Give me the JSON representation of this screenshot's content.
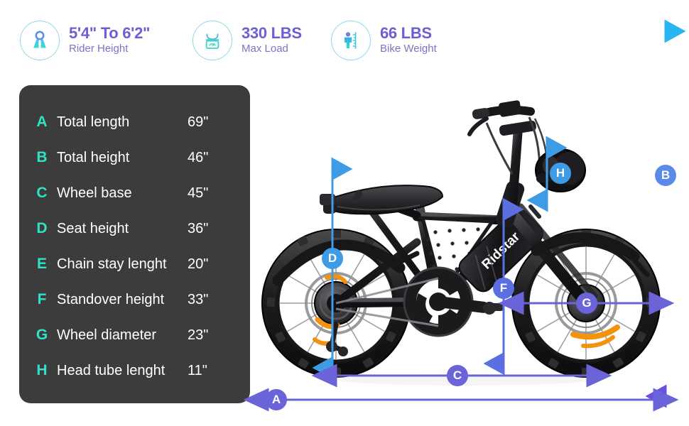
{
  "header": {
    "stats": [
      {
        "icon": "rider-height-icon",
        "value": "5'4\" To 6'2\"",
        "label": "Rider Height"
      },
      {
        "icon": "scale-icon",
        "value": "330 LBS",
        "label": "Max Load"
      },
      {
        "icon": "bike-weight-ruler-icon",
        "value": "66 LBS",
        "label": "Bike Weight"
      }
    ]
  },
  "spec_panel": {
    "rows": [
      {
        "letter": "A",
        "label": "Total length",
        "value": "69\""
      },
      {
        "letter": "B",
        "label": "Total height",
        "value": "46\""
      },
      {
        "letter": "C",
        "label": "Wheel base",
        "value": "45\""
      },
      {
        "letter": "D",
        "label": "Seat height",
        "value": "36\""
      },
      {
        "letter": "E",
        "label": "Chain stay lenght",
        "value": "20\""
      },
      {
        "letter": "F",
        "label": "Standover height",
        "value": "33\""
      },
      {
        "letter": "G",
        "label": "Wheel diameter",
        "value": "23\""
      },
      {
        "letter": "H",
        "label": "Head tube lenght",
        "value": "11\""
      }
    ]
  },
  "bike": {
    "brand_text": "Ridstar",
    "dimension_markers": [
      {
        "letter": "A",
        "orientation": "horizontal",
        "color": "#6b63d8"
      },
      {
        "letter": "B",
        "orientation": "vertical",
        "color": "#5b8ae8"
      },
      {
        "letter": "C",
        "orientation": "horizontal",
        "color": "#6b63d8"
      },
      {
        "letter": "D",
        "orientation": "vertical",
        "color": "#3e9ce6"
      },
      {
        "letter": "F",
        "orientation": "vertical",
        "color": "#5b6fe0"
      },
      {
        "letter": "G",
        "orientation": "horizontal",
        "color": "#6b63d8"
      },
      {
        "letter": "H",
        "orientation": "vertical",
        "color": "#3e9ce6"
      }
    ]
  },
  "colors": {
    "accent_purple": "#6b5fd6",
    "accent_teal": "#2fe3c8",
    "panel_bg": "#3c3c3c",
    "icon_ring": "#8fd8e8",
    "line_blue": "#3e9ce6",
    "line_purple": "#6b63d8"
  }
}
